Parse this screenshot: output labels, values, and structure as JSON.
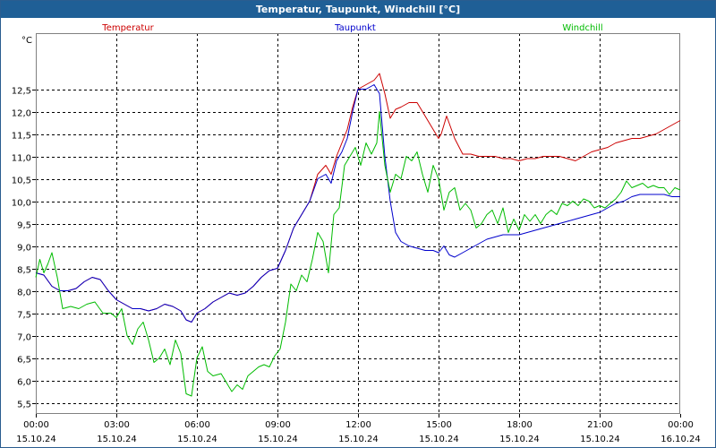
{
  "window": {
    "title": "Temperatur, Taupunkt, Windchill [°C]"
  },
  "chart_data": {
    "type": "line",
    "title": "Temperatur, Taupunkt, Windchill [°C]",
    "ylabel": "°C",
    "xlabel": "",
    "ylim": [
      5.25,
      13.75
    ],
    "xlim": [
      0,
      24
    ],
    "grid": true,
    "legend_placement": "top",
    "x_ticks": [
      0,
      3,
      6,
      9,
      12,
      15,
      18,
      21,
      24
    ],
    "x_tick_labels": [
      [
        "00:00",
        "15.10.24"
      ],
      [
        "03:00",
        "15.10.24"
      ],
      [
        "06:00",
        "15.10.24"
      ],
      [
        "09:00",
        "15.10.24"
      ],
      [
        "12:00",
        "15.10.24"
      ],
      [
        "15:00",
        "15.10.24"
      ],
      [
        "18:00",
        "15.10.24"
      ],
      [
        "21:00",
        "15.10.24"
      ],
      [
        "00:00",
        "16.10.24"
      ]
    ],
    "y_ticks": [
      5.5,
      6.0,
      6.5,
      7.0,
      7.5,
      8.0,
      8.5,
      9.0,
      9.5,
      10.0,
      10.5,
      11.0,
      11.5,
      12.0,
      12.5
    ],
    "y_tick_labels": [
      "5,5",
      "6,0",
      "6,5",
      "7,0",
      "7,5",
      "8,0",
      "8,5",
      "9,0",
      "9,5",
      "10,0",
      "10,5",
      "11,0",
      "11,5",
      "12,0",
      "12,5"
    ],
    "series": [
      {
        "name": "Temperatur",
        "color": "#cc0000",
        "points": [
          [
            0,
            8.4
          ],
          [
            0.3,
            8.35
          ],
          [
            0.6,
            8.1
          ],
          [
            0.9,
            8.0
          ],
          [
            1.2,
            8.0
          ],
          [
            1.5,
            8.05
          ],
          [
            1.8,
            8.2
          ],
          [
            2.1,
            8.3
          ],
          [
            2.4,
            8.25
          ],
          [
            2.7,
            8.0
          ],
          [
            3.0,
            7.8
          ],
          [
            3.3,
            7.7
          ],
          [
            3.6,
            7.6
          ],
          [
            3.9,
            7.6
          ],
          [
            4.2,
            7.55
          ],
          [
            4.5,
            7.6
          ],
          [
            4.8,
            7.7
          ],
          [
            5.1,
            7.65
          ],
          [
            5.4,
            7.55
          ],
          [
            5.6,
            7.35
          ],
          [
            5.8,
            7.3
          ],
          [
            6.0,
            7.5
          ],
          [
            6.3,
            7.6
          ],
          [
            6.6,
            7.75
          ],
          [
            6.9,
            7.85
          ],
          [
            7.2,
            7.95
          ],
          [
            7.5,
            7.9
          ],
          [
            7.8,
            7.95
          ],
          [
            8.1,
            8.1
          ],
          [
            8.4,
            8.3
          ],
          [
            8.7,
            8.45
          ],
          [
            9.0,
            8.5
          ],
          [
            9.3,
            8.9
          ],
          [
            9.6,
            9.4
          ],
          [
            9.9,
            9.7
          ],
          [
            10.2,
            10.0
          ],
          [
            10.5,
            10.6
          ],
          [
            10.8,
            10.8
          ],
          [
            11.0,
            10.6
          ],
          [
            11.2,
            11.0
          ],
          [
            11.4,
            11.3
          ],
          [
            11.6,
            11.6
          ],
          [
            11.8,
            12.1
          ],
          [
            12.0,
            12.5
          ],
          [
            12.3,
            12.6
          ],
          [
            12.6,
            12.7
          ],
          [
            12.8,
            12.85
          ],
          [
            13.0,
            12.4
          ],
          [
            13.2,
            11.85
          ],
          [
            13.4,
            12.05
          ],
          [
            13.6,
            12.1
          ],
          [
            13.9,
            12.2
          ],
          [
            14.2,
            12.2
          ],
          [
            14.4,
            12.0
          ],
          [
            14.7,
            11.7
          ],
          [
            15.0,
            11.4
          ],
          [
            15.1,
            11.5
          ],
          [
            15.3,
            11.9
          ],
          [
            15.6,
            11.4
          ],
          [
            15.9,
            11.05
          ],
          [
            16.2,
            11.05
          ],
          [
            16.5,
            11.0
          ],
          [
            16.8,
            11.0
          ],
          [
            17.1,
            11.0
          ],
          [
            17.4,
            10.95
          ],
          [
            17.7,
            10.95
          ],
          [
            18.0,
            10.9
          ],
          [
            18.3,
            10.95
          ],
          [
            18.6,
            10.95
          ],
          [
            18.9,
            11.0
          ],
          [
            19.2,
            11.0
          ],
          [
            19.5,
            11.0
          ],
          [
            19.8,
            10.95
          ],
          [
            20.1,
            10.9
          ],
          [
            20.4,
            11.0
          ],
          [
            20.7,
            11.1
          ],
          [
            21.0,
            11.15
          ],
          [
            21.3,
            11.2
          ],
          [
            21.6,
            11.3
          ],
          [
            21.9,
            11.35
          ],
          [
            22.2,
            11.4
          ],
          [
            22.5,
            11.4
          ],
          [
            22.8,
            11.45
          ],
          [
            23.1,
            11.5
          ],
          [
            23.4,
            11.6
          ],
          [
            23.7,
            11.7
          ],
          [
            24.0,
            11.8
          ]
        ]
      },
      {
        "name": "Taupunkt",
        "color": "#0000cc",
        "points": [
          [
            0,
            8.4
          ],
          [
            0.3,
            8.35
          ],
          [
            0.6,
            8.1
          ],
          [
            0.9,
            8.0
          ],
          [
            1.2,
            8.0
          ],
          [
            1.5,
            8.05
          ],
          [
            1.8,
            8.2
          ],
          [
            2.1,
            8.3
          ],
          [
            2.4,
            8.25
          ],
          [
            2.7,
            8.0
          ],
          [
            3.0,
            7.8
          ],
          [
            3.3,
            7.7
          ],
          [
            3.6,
            7.6
          ],
          [
            3.9,
            7.6
          ],
          [
            4.2,
            7.55
          ],
          [
            4.5,
            7.6
          ],
          [
            4.8,
            7.7
          ],
          [
            5.1,
            7.65
          ],
          [
            5.4,
            7.55
          ],
          [
            5.6,
            7.35
          ],
          [
            5.8,
            7.3
          ],
          [
            6.0,
            7.5
          ],
          [
            6.3,
            7.6
          ],
          [
            6.6,
            7.75
          ],
          [
            6.9,
            7.85
          ],
          [
            7.2,
            7.95
          ],
          [
            7.5,
            7.9
          ],
          [
            7.8,
            7.95
          ],
          [
            8.1,
            8.1
          ],
          [
            8.4,
            8.3
          ],
          [
            8.7,
            8.45
          ],
          [
            9.0,
            8.5
          ],
          [
            9.3,
            8.9
          ],
          [
            9.6,
            9.4
          ],
          [
            9.9,
            9.7
          ],
          [
            10.2,
            10.0
          ],
          [
            10.5,
            10.5
          ],
          [
            10.8,
            10.6
          ],
          [
            11.0,
            10.4
          ],
          [
            11.2,
            10.9
          ],
          [
            11.4,
            11.1
          ],
          [
            11.6,
            11.4
          ],
          [
            11.8,
            12.0
          ],
          [
            12.0,
            12.5
          ],
          [
            12.3,
            12.5
          ],
          [
            12.6,
            12.6
          ],
          [
            12.8,
            12.4
          ],
          [
            13.0,
            11.0
          ],
          [
            13.2,
            10.0
          ],
          [
            13.4,
            9.3
          ],
          [
            13.6,
            9.1
          ],
          [
            13.9,
            9.0
          ],
          [
            14.2,
            8.95
          ],
          [
            14.5,
            8.9
          ],
          [
            14.8,
            8.9
          ],
          [
            15.0,
            8.85
          ],
          [
            15.2,
            9.0
          ],
          [
            15.4,
            8.8
          ],
          [
            15.6,
            8.75
          ],
          [
            15.9,
            8.85
          ],
          [
            16.2,
            8.95
          ],
          [
            16.5,
            9.05
          ],
          [
            16.8,
            9.15
          ],
          [
            17.1,
            9.2
          ],
          [
            17.4,
            9.25
          ],
          [
            17.7,
            9.25
          ],
          [
            18.0,
            9.25
          ],
          [
            18.3,
            9.3
          ],
          [
            18.6,
            9.35
          ],
          [
            18.9,
            9.4
          ],
          [
            19.2,
            9.45
          ],
          [
            19.5,
            9.5
          ],
          [
            19.8,
            9.55
          ],
          [
            20.1,
            9.6
          ],
          [
            20.4,
            9.65
          ],
          [
            20.7,
            9.7
          ],
          [
            21.0,
            9.75
          ],
          [
            21.3,
            9.85
          ],
          [
            21.6,
            9.95
          ],
          [
            21.9,
            10.0
          ],
          [
            22.2,
            10.1
          ],
          [
            22.5,
            10.15
          ],
          [
            22.8,
            10.15
          ],
          [
            23.1,
            10.15
          ],
          [
            23.4,
            10.15
          ],
          [
            23.7,
            10.1
          ],
          [
            24.0,
            10.1
          ]
        ]
      },
      {
        "name": "Windchill",
        "color": "#00bb00",
        "points": [
          [
            0,
            8.3
          ],
          [
            0.15,
            8.7
          ],
          [
            0.3,
            8.4
          ],
          [
            0.45,
            8.6
          ],
          [
            0.6,
            8.85
          ],
          [
            0.8,
            8.3
          ],
          [
            1.0,
            7.6
          ],
          [
            1.3,
            7.65
          ],
          [
            1.6,
            7.6
          ],
          [
            1.9,
            7.7
          ],
          [
            2.2,
            7.75
          ],
          [
            2.5,
            7.5
          ],
          [
            2.8,
            7.5
          ],
          [
            3.0,
            7.4
          ],
          [
            3.2,
            7.6
          ],
          [
            3.4,
            7.0
          ],
          [
            3.6,
            6.8
          ],
          [
            3.8,
            7.15
          ],
          [
            4.0,
            7.3
          ],
          [
            4.2,
            6.9
          ],
          [
            4.4,
            6.4
          ],
          [
            4.6,
            6.5
          ],
          [
            4.8,
            6.7
          ],
          [
            5.0,
            6.35
          ],
          [
            5.2,
            6.9
          ],
          [
            5.4,
            6.6
          ],
          [
            5.6,
            5.7
          ],
          [
            5.8,
            5.65
          ],
          [
            6.0,
            6.5
          ],
          [
            6.2,
            6.75
          ],
          [
            6.4,
            6.2
          ],
          [
            6.6,
            6.1
          ],
          [
            6.9,
            6.15
          ],
          [
            7.1,
            5.95
          ],
          [
            7.3,
            5.75
          ],
          [
            7.5,
            5.9
          ],
          [
            7.7,
            5.8
          ],
          [
            7.9,
            6.1
          ],
          [
            8.1,
            6.2
          ],
          [
            8.3,
            6.3
          ],
          [
            8.5,
            6.35
          ],
          [
            8.7,
            6.3
          ],
          [
            8.9,
            6.55
          ],
          [
            9.1,
            6.7
          ],
          [
            9.3,
            7.3
          ],
          [
            9.5,
            8.15
          ],
          [
            9.7,
            8.0
          ],
          [
            9.9,
            8.35
          ],
          [
            10.1,
            8.2
          ],
          [
            10.3,
            8.7
          ],
          [
            10.5,
            9.3
          ],
          [
            10.7,
            9.1
          ],
          [
            10.9,
            8.4
          ],
          [
            11.1,
            9.7
          ],
          [
            11.3,
            9.85
          ],
          [
            11.5,
            10.8
          ],
          [
            11.7,
            11.0
          ],
          [
            11.9,
            11.2
          ],
          [
            12.1,
            10.8
          ],
          [
            12.3,
            11.3
          ],
          [
            12.5,
            11.05
          ],
          [
            12.7,
            11.3
          ],
          [
            12.8,
            12.0
          ],
          [
            13.0,
            10.8
          ],
          [
            13.2,
            10.2
          ],
          [
            13.4,
            10.6
          ],
          [
            13.6,
            10.5
          ],
          [
            13.8,
            11.0
          ],
          [
            14.0,
            10.9
          ],
          [
            14.2,
            11.1
          ],
          [
            14.4,
            10.6
          ],
          [
            14.6,
            10.2
          ],
          [
            14.8,
            10.8
          ],
          [
            15.0,
            10.5
          ],
          [
            15.2,
            9.8
          ],
          [
            15.4,
            10.2
          ],
          [
            15.6,
            10.3
          ],
          [
            15.8,
            9.8
          ],
          [
            16.0,
            9.95
          ],
          [
            16.2,
            9.8
          ],
          [
            16.4,
            9.4
          ],
          [
            16.6,
            9.5
          ],
          [
            16.8,
            9.7
          ],
          [
            17.0,
            9.8
          ],
          [
            17.2,
            9.5
          ],
          [
            17.4,
            9.85
          ],
          [
            17.6,
            9.3
          ],
          [
            17.8,
            9.6
          ],
          [
            18.0,
            9.35
          ],
          [
            18.2,
            9.7
          ],
          [
            18.4,
            9.55
          ],
          [
            18.6,
            9.7
          ],
          [
            18.8,
            9.5
          ],
          [
            19.0,
            9.7
          ],
          [
            19.2,
            9.8
          ],
          [
            19.4,
            9.7
          ],
          [
            19.6,
            9.95
          ],
          [
            19.8,
            9.9
          ],
          [
            20.0,
            10.0
          ],
          [
            20.2,
            9.9
          ],
          [
            20.4,
            10.05
          ],
          [
            20.6,
            10.0
          ],
          [
            20.8,
            9.85
          ],
          [
            21.0,
            9.9
          ],
          [
            21.2,
            9.85
          ],
          [
            21.4,
            9.95
          ],
          [
            21.6,
            10.05
          ],
          [
            21.8,
            10.2
          ],
          [
            22.0,
            10.45
          ],
          [
            22.2,
            10.3
          ],
          [
            22.4,
            10.35
          ],
          [
            22.6,
            10.4
          ],
          [
            22.8,
            10.3
          ],
          [
            23.0,
            10.35
          ],
          [
            23.2,
            10.3
          ],
          [
            23.4,
            10.3
          ],
          [
            23.6,
            10.15
          ],
          [
            23.8,
            10.3
          ],
          [
            24.0,
            10.25
          ]
        ]
      }
    ]
  }
}
